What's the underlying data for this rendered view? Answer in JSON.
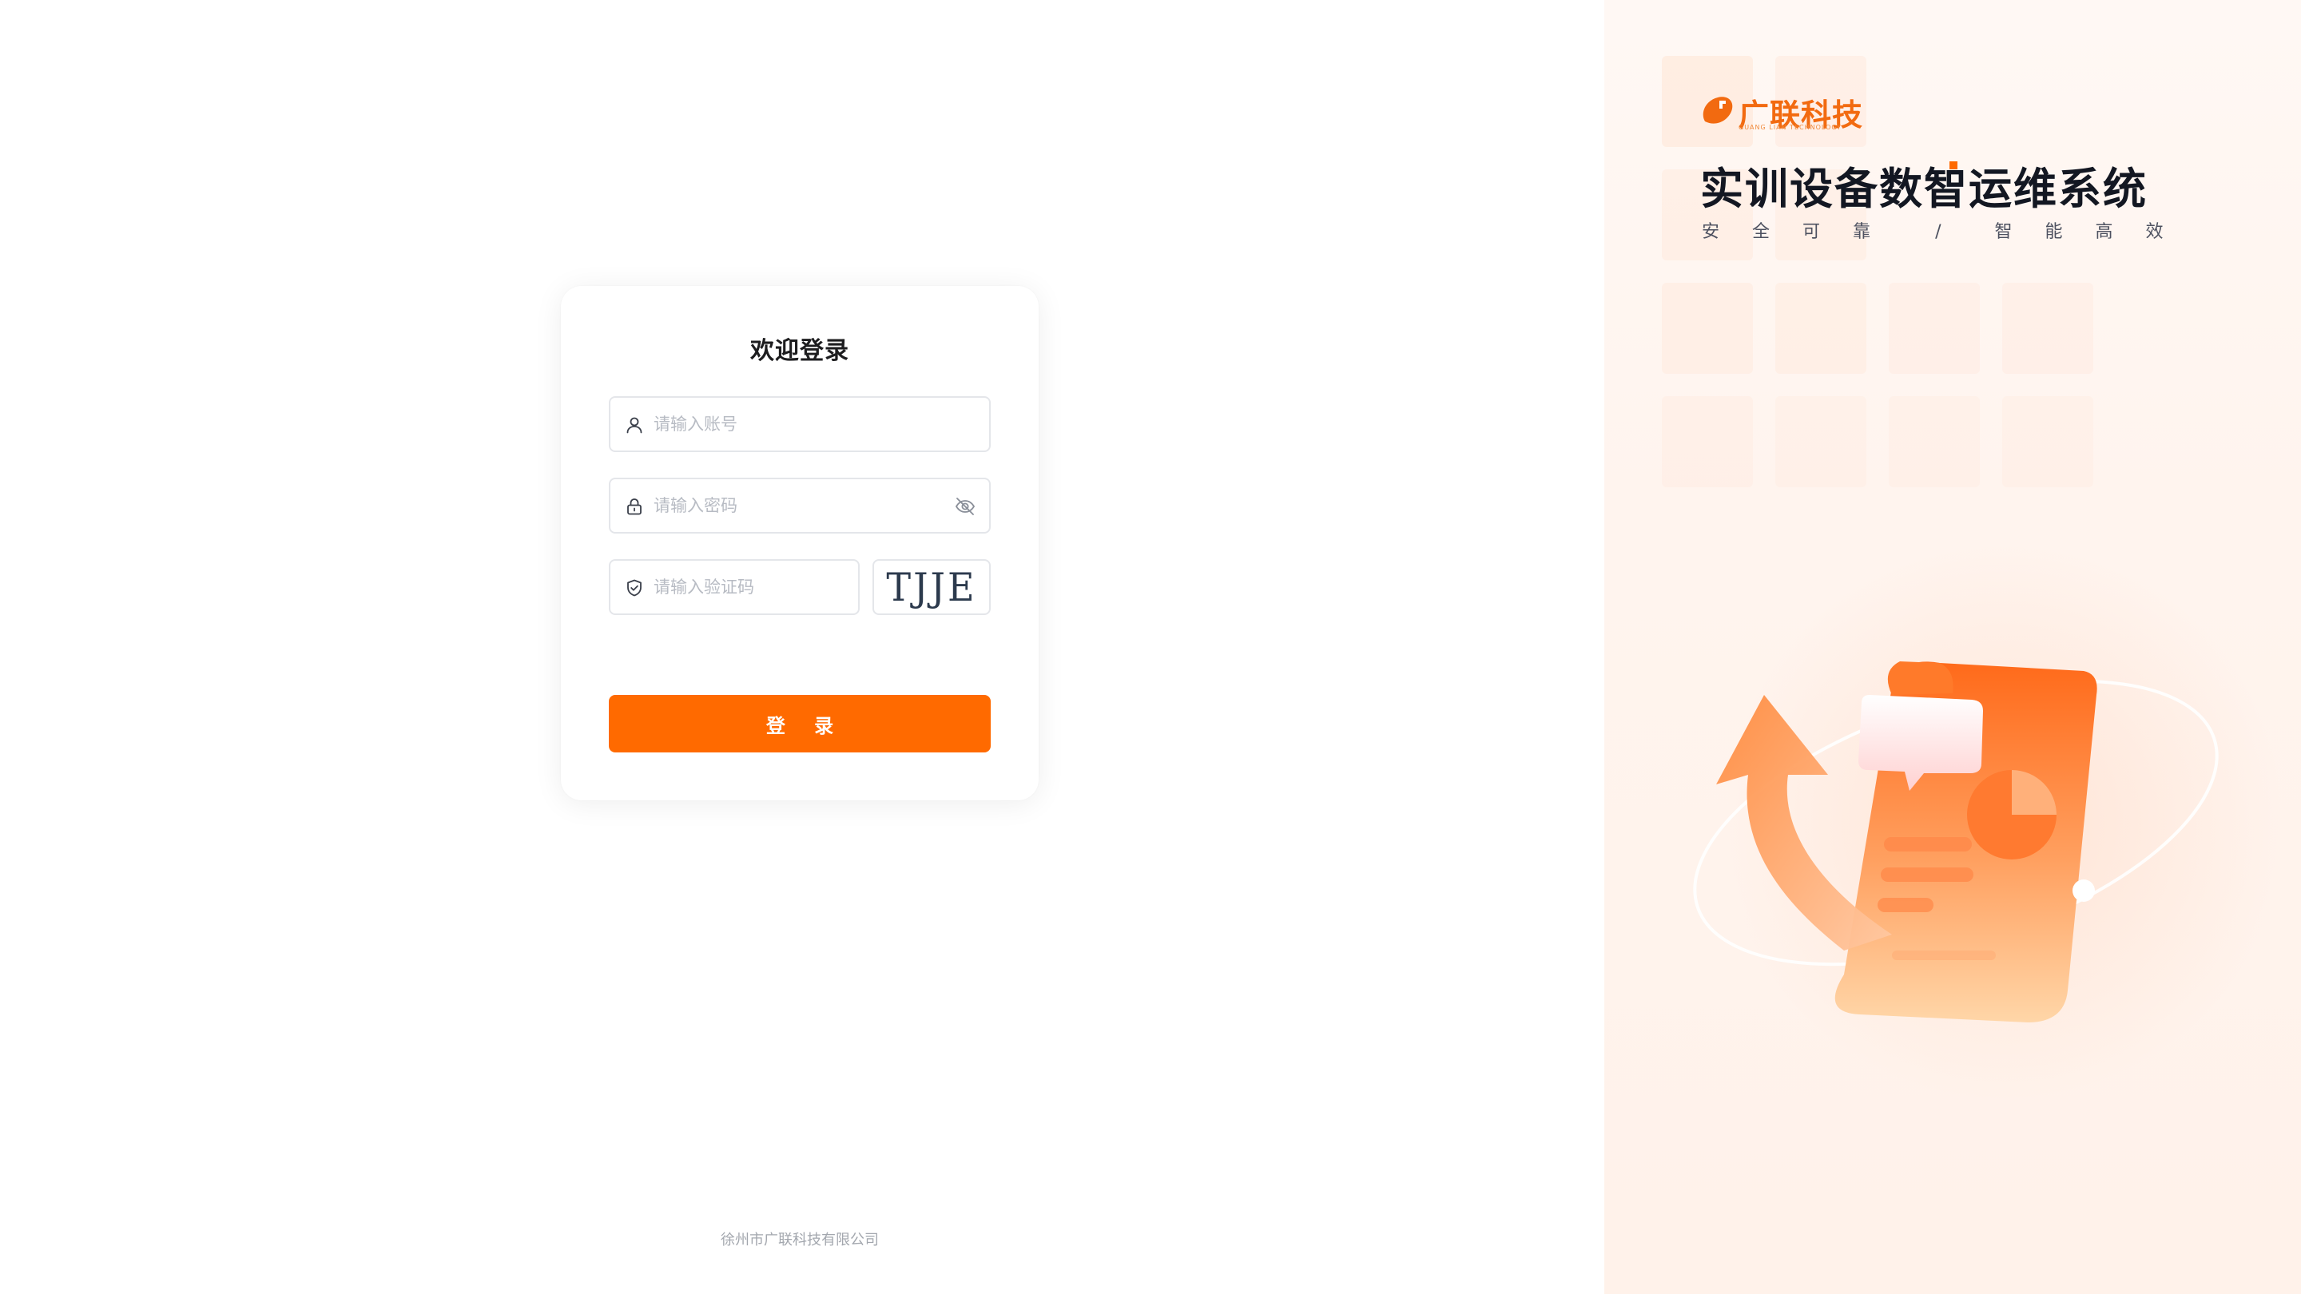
{
  "login": {
    "title": "欢迎登录",
    "account_placeholder": "请输入账号",
    "password_placeholder": "请输入密码",
    "captcha_placeholder": "请输入验证码",
    "captcha_text": "TJJE",
    "login_button": "登 录"
  },
  "footer": {
    "company": "徐州市广联科技有限公司"
  },
  "brand": {
    "logo_text": "广联科技",
    "logo_subtext": "GUANG LIAN TECHNOLOGY",
    "system_title": "实训设备数智运维系统",
    "slogan_left": [
      "安",
      "全",
      "可",
      "靠"
    ],
    "slogan_sep": "/",
    "slogan_right": [
      "智",
      "能",
      "高",
      "效"
    ]
  },
  "icons": {
    "account": "user-icon",
    "password": "lock-icon",
    "password_toggle": "eye-off-icon",
    "captcha": "shield-check-icon"
  },
  "colors": {
    "accent": "#ff6a00",
    "text": "#1d1d1f",
    "placeholder": "#b7bbc3"
  }
}
